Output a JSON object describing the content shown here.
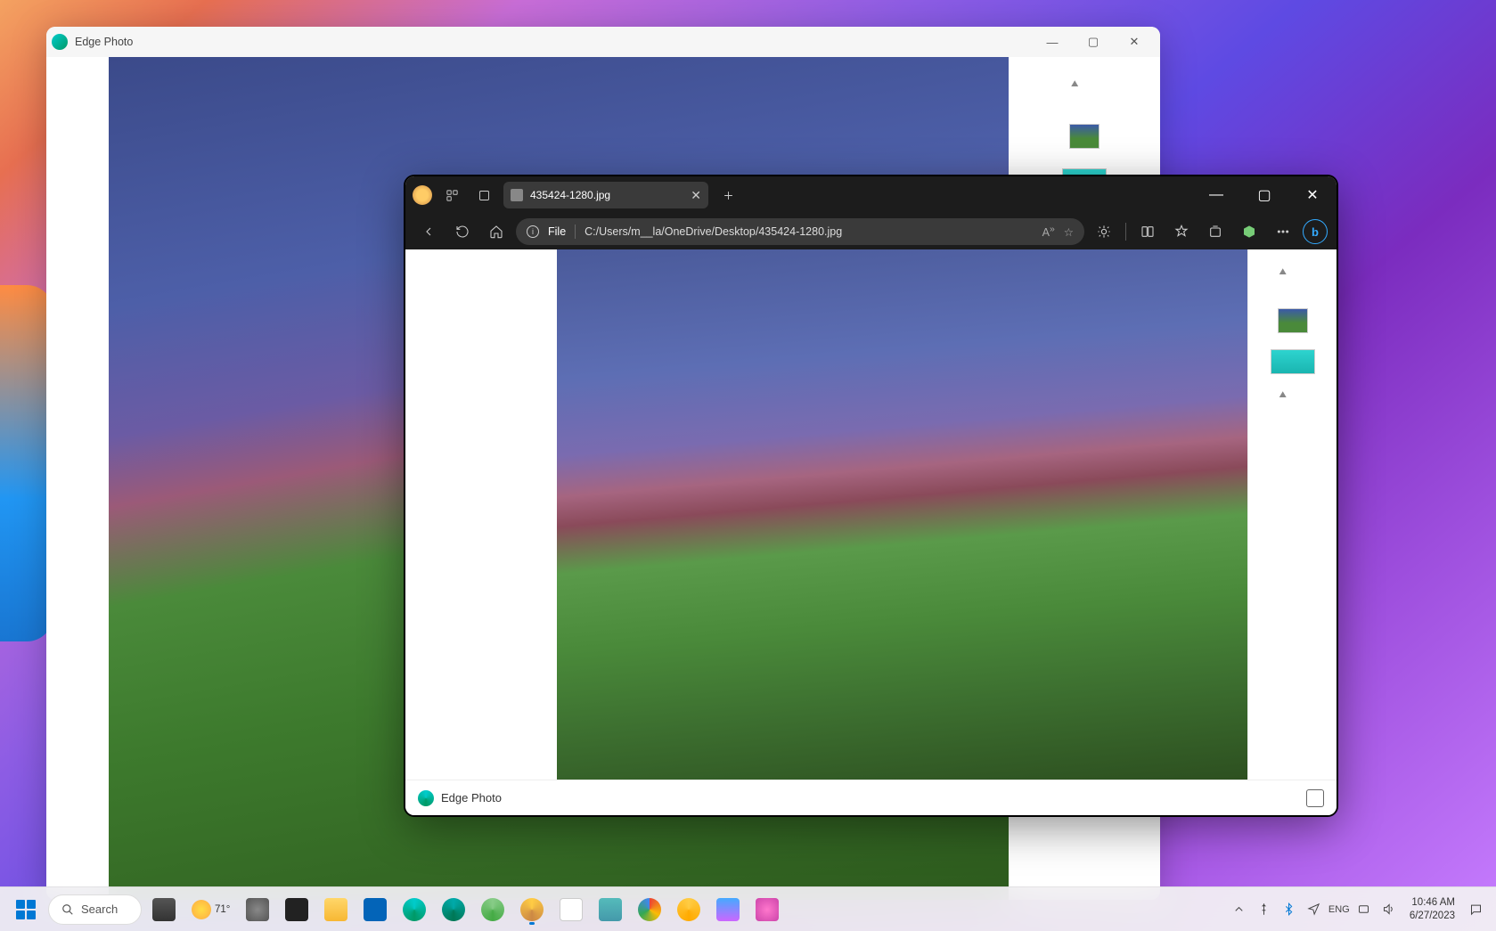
{
  "back_window": {
    "title": "Edge Photo"
  },
  "front_window": {
    "tab_title": "435424-1280.jpg",
    "address": {
      "scheme": "File",
      "path": "C:/Users/m__la/OneDrive/Desktop/435424-1280.jpg"
    },
    "status_label": "Edge Photo"
  },
  "taskbar": {
    "search_label": "Search",
    "weather_temp": "71°",
    "language": "ENG",
    "clock_time": "10:46 AM",
    "clock_date": "6/27/2023"
  }
}
